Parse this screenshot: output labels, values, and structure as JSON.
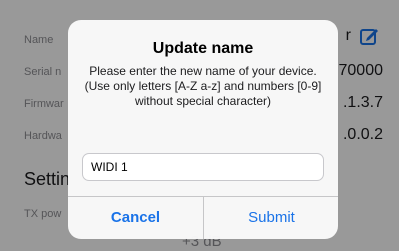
{
  "background": {
    "rows": [
      {
        "label": "Name",
        "value": "r"
      },
      {
        "label": "Serial n",
        "value": "70000"
      },
      {
        "label": "Firmwar",
        "value": ".1.3.7"
      },
      {
        "label": "Hardwa",
        "value": ".0.0.2"
      }
    ],
    "section_title": "Settin",
    "tx_label": "TX pow",
    "tx_value": "+3 dB",
    "edit_icon": "edit-icon",
    "accent_color": "#1a73e8"
  },
  "dialog": {
    "title": "Update name",
    "message": "Please enter the new name of your device. (Use only letters [A-Z a-z] and numbers [0-9] without special character)",
    "input_value": "WIDI 1",
    "cancel_label": "Cancel",
    "submit_label": "Submit"
  }
}
